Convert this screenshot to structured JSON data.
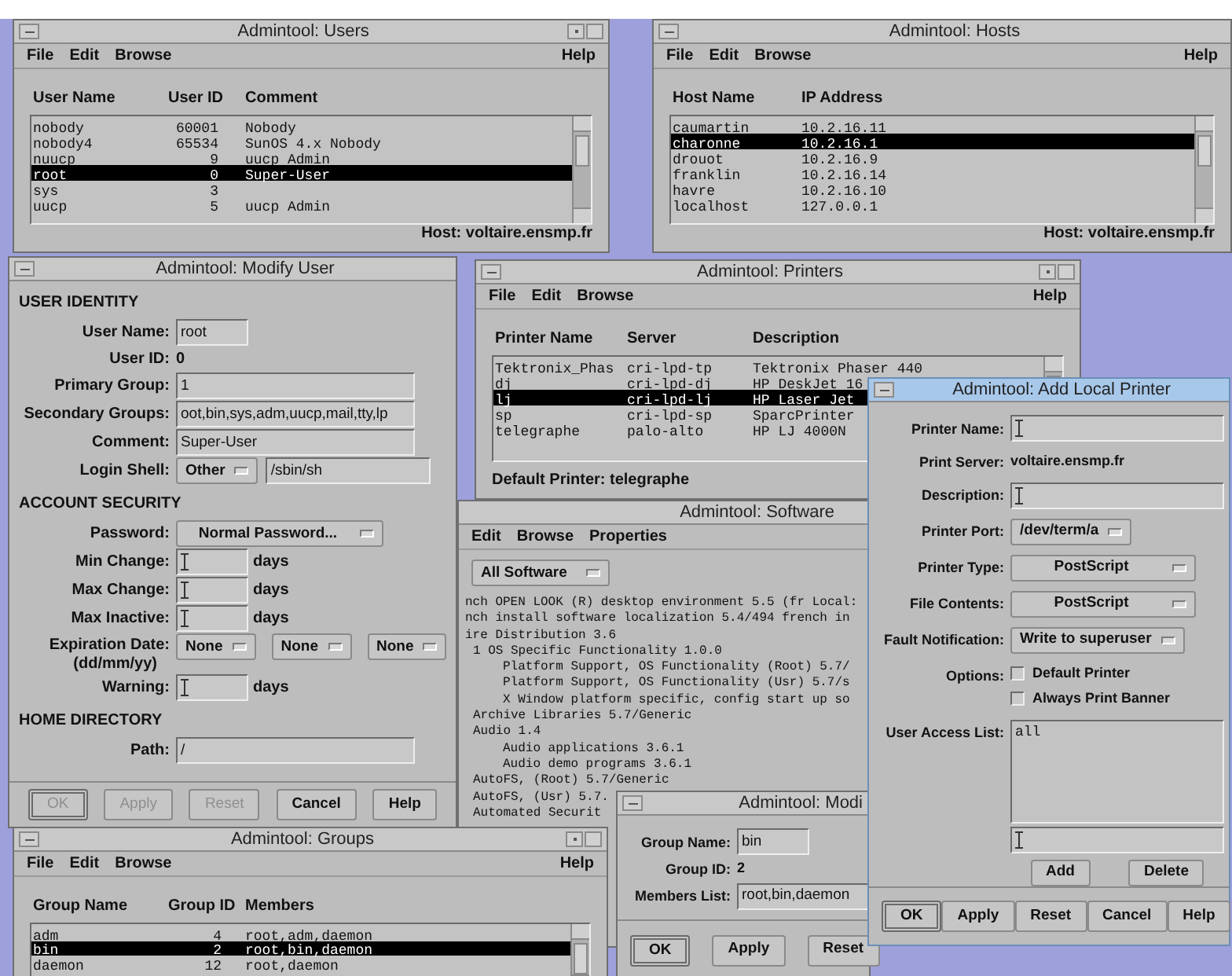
{
  "users_window": {
    "title": "Admintool: Users",
    "active": false,
    "menu": [
      "File",
      "Edit",
      "Browse"
    ],
    "help": "Help",
    "columns": [
      {
        "label": "User Name",
        "kind": "text"
      },
      {
        "label": "User ID",
        "kind": "number"
      },
      {
        "label": "Comment",
        "kind": "text"
      }
    ],
    "rows": [
      {
        "cells": [
          "nobody",
          "60001",
          "Nobody"
        ],
        "selected": false
      },
      {
        "cells": [
          "nobody4",
          "65534",
          "SunOS 4.x Nobody"
        ],
        "selected": false
      },
      {
        "cells": [
          "nuucp",
          "9",
          "uucp Admin"
        ],
        "selected": false
      },
      {
        "cells": [
          "root",
          "0",
          "Super-User"
        ],
        "selected": true
      },
      {
        "cells": [
          "sys",
          "3"
        ],
        "selected": false
      },
      {
        "cells": [
          "uucp",
          "5",
          "uucp Admin"
        ],
        "selected": false
      }
    ],
    "footer": "Host: voltaire.ensmp.fr"
  },
  "hosts_window": {
    "title": "Admintool: Hosts",
    "active": false,
    "menu": [
      "File",
      "Edit",
      "Browse"
    ],
    "help": "Help",
    "columns": [
      {
        "label": "Host Name"
      },
      {
        "label": "IP Address"
      }
    ],
    "rows": [
      {
        "cells": [
          "caumartin",
          "10.2.16.11"
        ],
        "selected": false
      },
      {
        "cells": [
          "charonne",
          "10.2.16.1"
        ],
        "selected": true
      },
      {
        "cells": [
          "drouot",
          "10.2.16.9"
        ],
        "selected": false
      },
      {
        "cells": [
          "franklin",
          "10.2.16.14"
        ],
        "selected": false
      },
      {
        "cells": [
          "havre",
          "10.2.16.10"
        ],
        "selected": false
      },
      {
        "cells": [
          "localhost",
          "127.0.0.1"
        ],
        "selected": false
      }
    ],
    "footer": "Host: voltaire.ensmp.fr"
  },
  "software_window": {
    "title": "Admintool: Software",
    "active": false,
    "menu": [
      "Edit",
      "Browse",
      "Properties"
    ],
    "filter": "All Software",
    "items": [
      {
        "text": "nch OPEN LOOK (R) desktop environment 5.5 (fr Local:"
      },
      {
        "text": "nch install software localization 5.4/494 french in"
      },
      {
        "text": "ire Distribution 3.6",
        "children": [
          {
            "text": "1 OS Specific Functionality 1.0.0",
            "children": [
              {
                "text": "Platform Support, OS Functionality (Root) 5.7/"
              },
              {
                "text": "Platform Support, OS Functionality (Usr) 5.7/s"
              },
              {
                "text": "X Window platform specific, config start up so"
              }
            ]
          },
          {
            "text": "Archive Libraries 5.7/Generic"
          },
          {
            "text": "Audio 1.4",
            "children": [
              {
                "text": "Audio applications 3.6.1"
              },
              {
                "text": "Audio demo programs 3.6.1"
              }
            ]
          },
          {
            "text": "AutoFS, (Root) 5.7/Generic"
          },
          {
            "text": "AutoFS, (Usr) 5.7."
          },
          {
            "text": "Automated Securit"
          }
        ]
      }
    ]
  },
  "printers_window": {
    "title": "Admintool: Printers",
    "active": false,
    "menu": [
      "File",
      "Edit",
      "Browse"
    ],
    "help": "Help",
    "columns": [
      {
        "label": "Printer Name"
      },
      {
        "label": "Server"
      },
      {
        "label": "Description"
      }
    ],
    "rows": [
      {
        "cells": [
          "Tektronix_Phas",
          "cri-lpd-tp",
          "Tektronix Phaser 440"
        ],
        "selected": false
      },
      {
        "cells": [
          "dj",
          "cri-lpd-dj",
          "HP DeskJet 16"
        ],
        "selected": false
      },
      {
        "cells": [
          "lj",
          "cri-lpd-lj",
          "HP Laser Jet"
        ],
        "selected": true
      },
      {
        "cells": [
          "sp",
          "cri-lpd-sp",
          "SparcPrinter"
        ],
        "selected": false
      },
      {
        "cells": [
          "telegraphe",
          "palo-alto",
          "HP LJ 4000N"
        ],
        "selected": false
      }
    ],
    "footer": "Default Printer: telegraphe"
  },
  "modify_user_window": {
    "title": "Admintool: Modify User",
    "active": false,
    "sections": [
      {
        "heading": "USER IDENTITY",
        "fields": [
          {
            "kind": "short_input",
            "label": "User Name:",
            "value": "root"
          },
          {
            "kind": "text",
            "label": "User ID:",
            "value": "0"
          },
          {
            "kind": "input",
            "label": "Primary Group:",
            "value": "1"
          },
          {
            "kind": "input",
            "label": "Secondary Groups:",
            "value": "oot,bin,sys,adm,uucp,mail,tty,lp"
          },
          {
            "kind": "input",
            "label": "Comment:",
            "value": "Super-User"
          },
          {
            "kind": "menu_input",
            "label": "Login Shell:",
            "menu": "Other",
            "value": "/sbin/sh"
          }
        ]
      },
      {
        "heading": "ACCOUNT SECURITY",
        "fields": [
          {
            "kind": "wide_menu",
            "label": "Password:",
            "menu": "Normal Password..."
          },
          {
            "kind": "short_input",
            "label": "Min Change:",
            "suffix": "days"
          },
          {
            "kind": "short_input",
            "label": "Max Change:",
            "suffix": "days"
          },
          {
            "kind": "short_input",
            "label": "Max Inactive:",
            "suffix": "days"
          },
          {
            "kind": "date",
            "label": "Expiration Date:",
            "sublabel": "(dd/mm/yy)",
            "menus": [
              "None",
              "None",
              "None"
            ]
          },
          {
            "kind": "short_input",
            "label": "Warning:",
            "suffix": "days"
          }
        ]
      },
      {
        "heading": "HOME DIRECTORY",
        "fields": [
          {
            "kind": "input",
            "label": "Path:",
            "value": "/"
          }
        ]
      }
    ],
    "buttons": [
      {
        "label": "OK",
        "disabled": true,
        "default": true
      },
      {
        "label": "Apply",
        "disabled": true,
        "default": false
      },
      {
        "label": "Reset",
        "disabled": true,
        "default": false
      },
      {
        "label": "Cancel",
        "disabled": false,
        "default": false
      },
      {
        "label": "Help",
        "disabled": false,
        "default": false
      }
    ]
  },
  "groups_window": {
    "title": "Admintool: Groups",
    "active": false,
    "menu": [
      "File",
      "Edit",
      "Browse"
    ],
    "help": "Help",
    "columns": [
      {
        "label": "Group Name",
        "kind": "text"
      },
      {
        "label": "Group ID",
        "kind": "number"
      },
      {
        "label": "Members",
        "kind": "text"
      }
    ],
    "rows": [
      {
        "cells": [
          "adm",
          "4",
          "root,adm,daemon"
        ],
        "selected": false
      },
      {
        "cells": [
          "bin",
          "2",
          "root,bin,daemon"
        ],
        "selected": true
      },
      {
        "cells": [
          "daemon",
          "12",
          "root,daemon"
        ],
        "selected": false
      }
    ]
  },
  "modify_group_window": {
    "title": "Admintool: Modi",
    "active": false,
    "fields": [
      {
        "kind": "short_input",
        "label": "Group Name:",
        "value": "bin"
      },
      {
        "kind": "text",
        "label": "Group ID:",
        "value": "2"
      },
      {
        "kind": "input",
        "label": "Members List:",
        "value": "root,bin,daemon"
      }
    ],
    "buttons": [
      {
        "label": "OK",
        "disabled": false,
        "default": true
      },
      {
        "label": "Apply",
        "disabled": false,
        "default": false
      },
      {
        "label": "Reset",
        "disabled": false,
        "default": false
      }
    ]
  },
  "add_printer_window": {
    "title": "Admintool: Add Local Printer",
    "active": true,
    "fields": [
      {
        "kind": "input",
        "label": "Printer Name:"
      },
      {
        "kind": "text",
        "label": "Print Server:",
        "value": "voltaire.ensmp.fr"
      },
      {
        "kind": "input",
        "label": "Description:"
      },
      {
        "kind": "menu",
        "label": "Printer Port:",
        "menu": "/dev/term/a"
      },
      {
        "kind": "wide_menu",
        "label": "Printer Type:",
        "menu": "PostScript"
      },
      {
        "kind": "wide_menu",
        "label": "File Contents:",
        "menu": "PostScript"
      },
      {
        "kind": "menu",
        "label": "Fault Notification:",
        "menu": "Write to superuser"
      },
      {
        "kind": "checkboxes",
        "label": "Options:",
        "options": [
          {
            "label": "Default Printer",
            "checked": false
          },
          {
            "label": "Always Print Banner",
            "checked": false
          }
        ]
      },
      {
        "kind": "access_list",
        "label": "User Access List:",
        "entries": [
          "all"
        ],
        "actions": [
          "Add",
          "Delete"
        ]
      }
    ],
    "buttons": [
      {
        "label": "OK",
        "disabled": false,
        "default": true
      },
      {
        "label": "Apply",
        "disabled": false,
        "default": false
      },
      {
        "label": "Reset",
        "disabled": false,
        "default": false
      },
      {
        "label": "Cancel",
        "disabled": false,
        "default": false
      },
      {
        "label": "Help",
        "disabled": false,
        "default": false
      }
    ]
  }
}
